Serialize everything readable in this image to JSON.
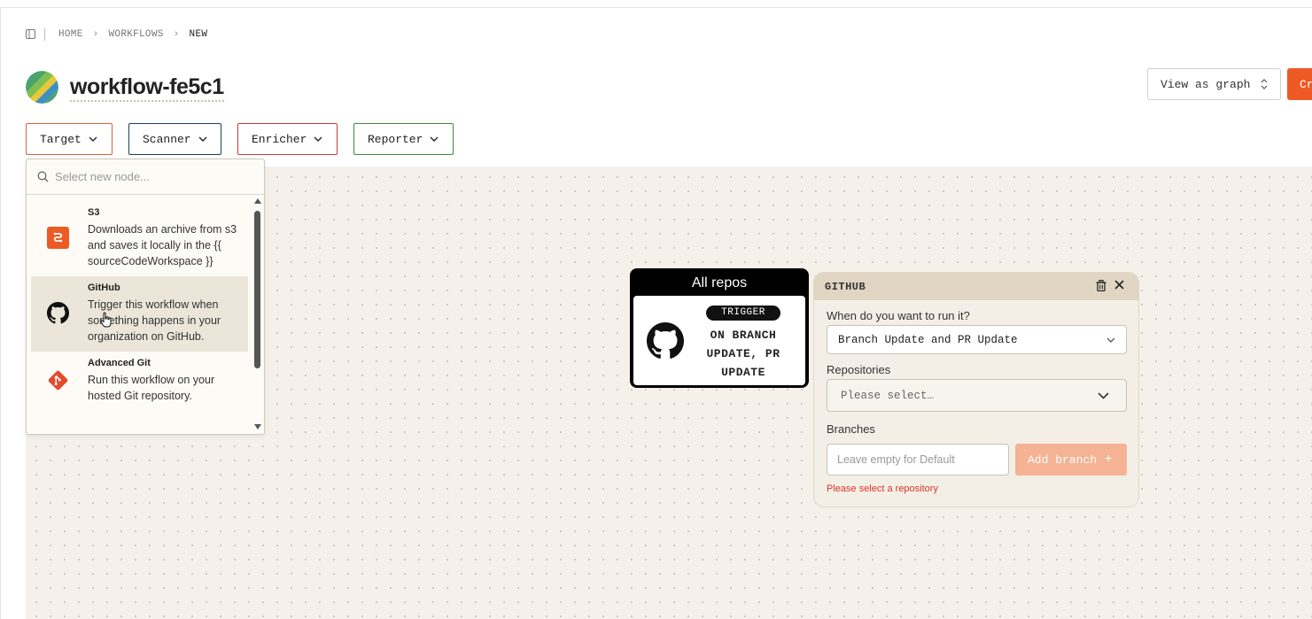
{
  "breadcrumb": {
    "items": [
      "HOME",
      "WORKFLOWS",
      "NEW"
    ]
  },
  "workflow": {
    "title": "workflow-fe5c1"
  },
  "header": {
    "view_as_graph": "View as graph",
    "create_label": "Cr"
  },
  "node_types": {
    "target": "Target",
    "scanner": "Scanner",
    "enricher": "Enricher",
    "reporter": "Reporter"
  },
  "dropdown": {
    "search_placeholder": "Select new node...",
    "items": [
      {
        "name": "S3",
        "desc": "Downloads an archive from s3 and saves it locally in the {{ sourceCodeWorkspace }}",
        "icon": "s3-icon"
      },
      {
        "name": "GitHub",
        "desc": "Trigger this workflow when something happens in your organization on GitHub.",
        "icon": "github-icon"
      },
      {
        "name": "Advanced Git",
        "desc": "Run this workflow on your hosted Git repository.",
        "icon": "git-icon"
      }
    ]
  },
  "trigger_node": {
    "title": "All repos",
    "badge": "TRIGGER",
    "text": "ON BRANCH UPDATE, PR UPDATE"
  },
  "github_panel": {
    "title": "GITHUB",
    "run_label": "When do you want to run it?",
    "run_value": "Branch Update and PR Update",
    "repos_label": "Repositories",
    "repos_value": "Please select…",
    "branches_label": "Branches",
    "branches_placeholder": "Leave empty for Default",
    "add_branch": "Add branch",
    "add_branch_plus": "+",
    "error": "Please select a repository"
  },
  "colors": {
    "accent": "#ed5a24",
    "target": "#d9623a",
    "scanner": "#1f3f5a",
    "enricher": "#cc3a3a",
    "reporter": "#3b8a3b",
    "error": "#d9342b"
  }
}
